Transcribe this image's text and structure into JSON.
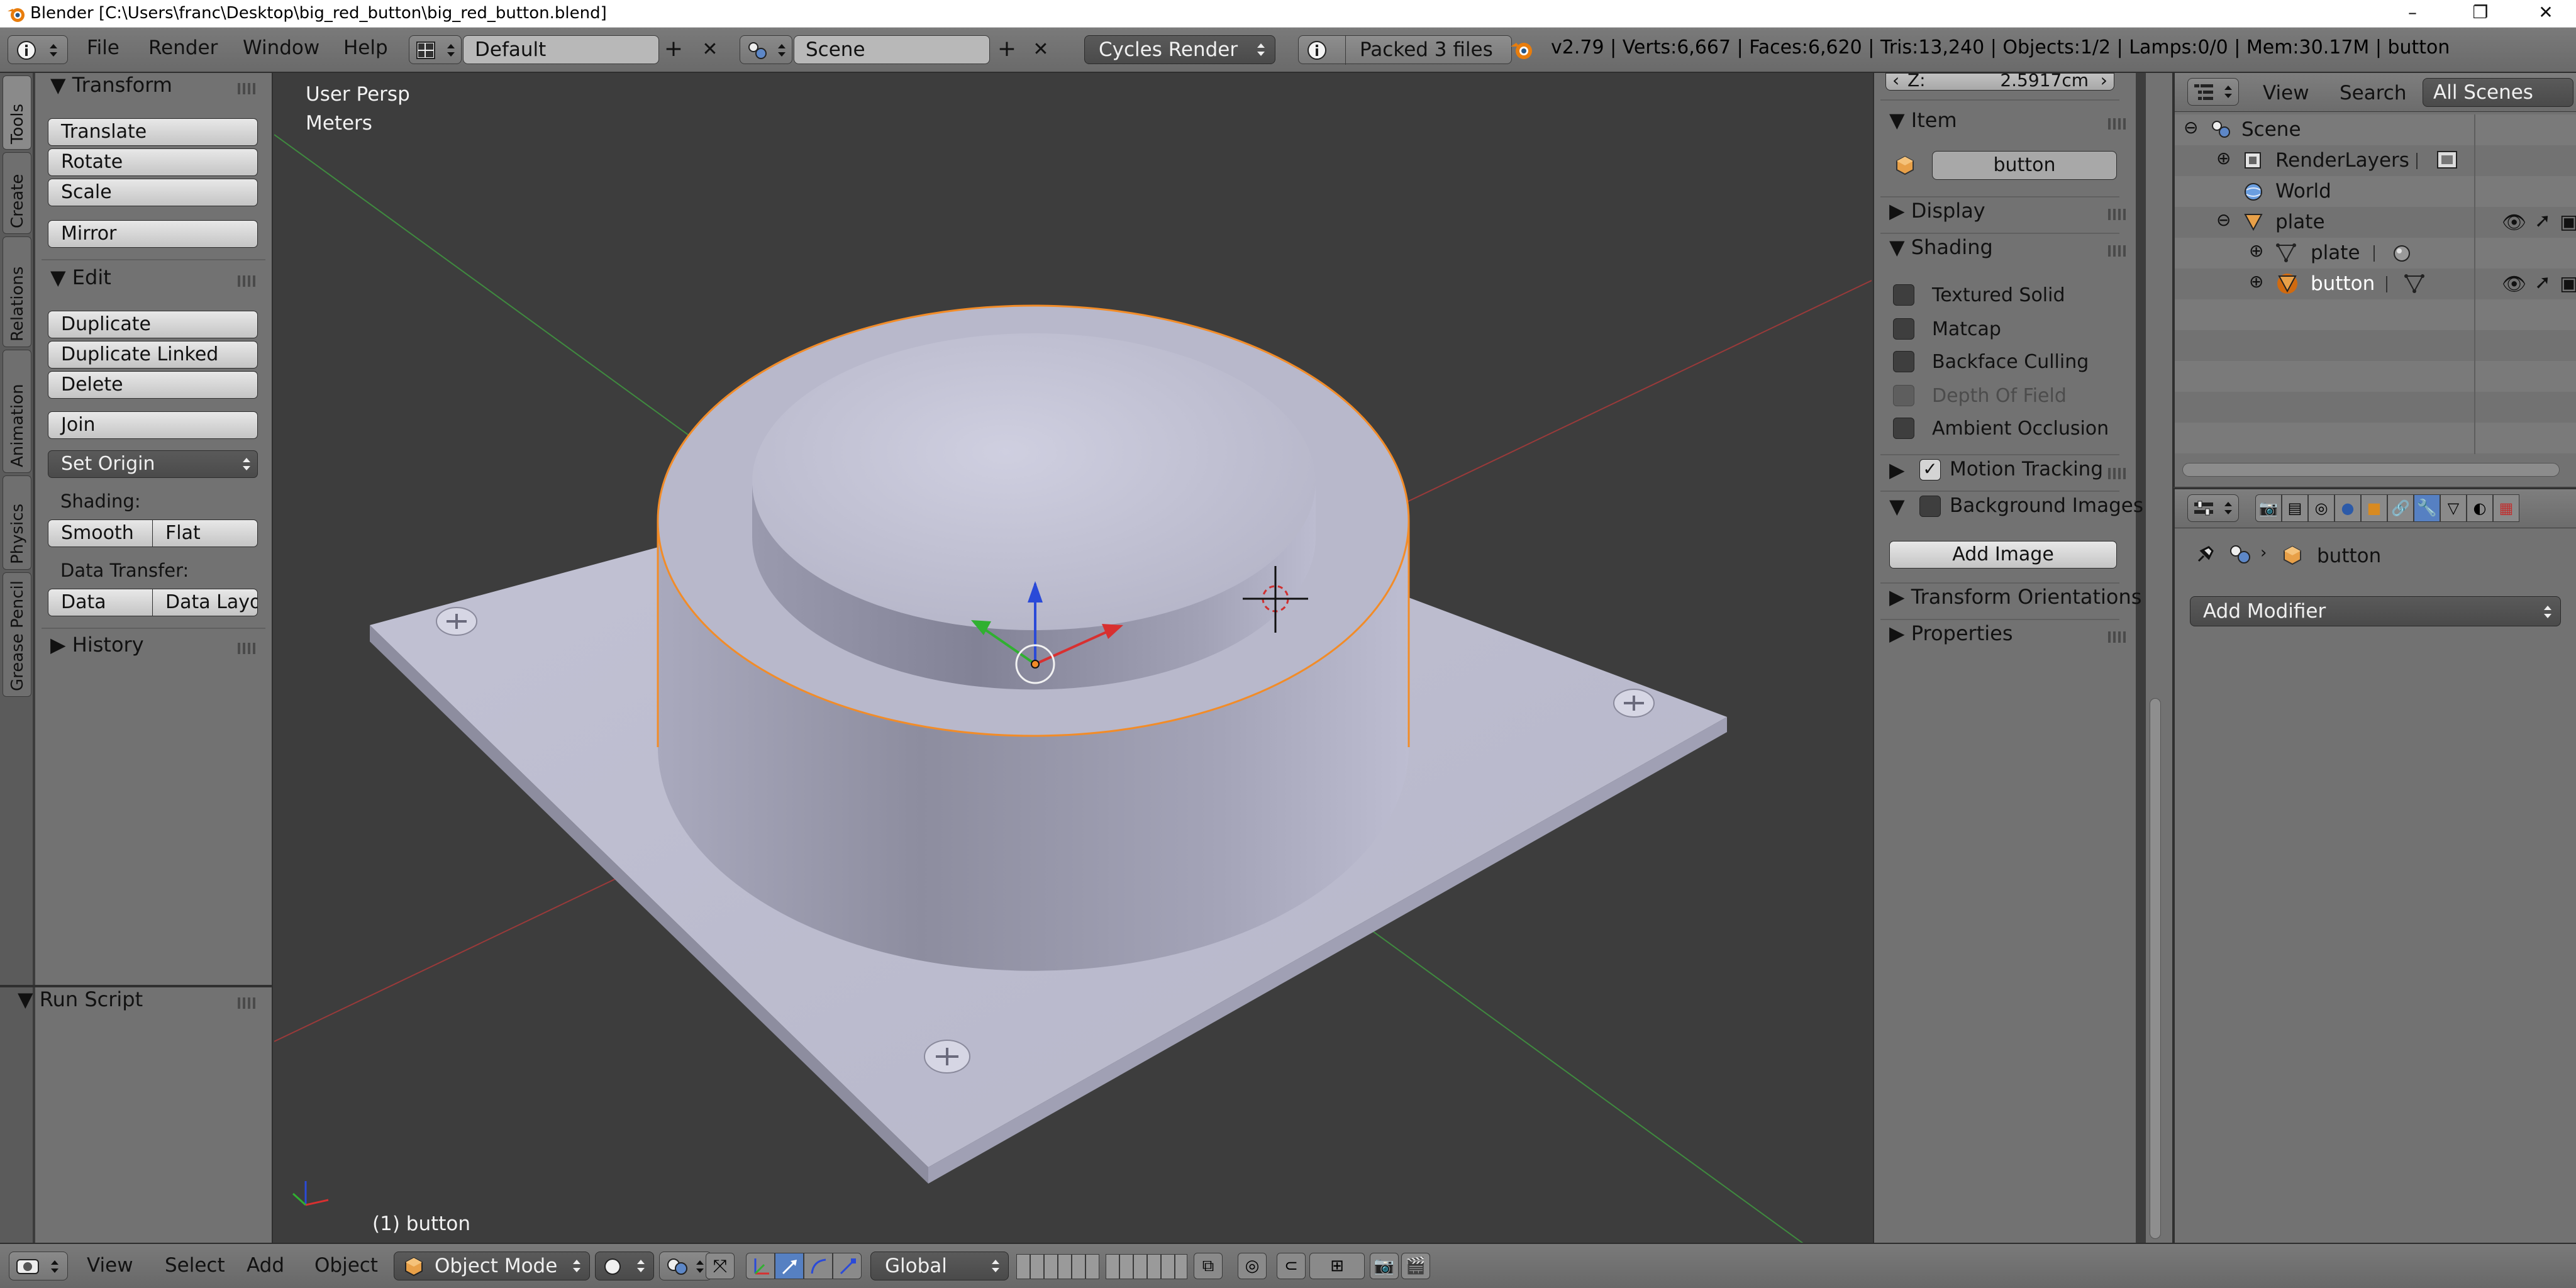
{
  "titlebar": {
    "title": "Blender [C:\\Users\\franc\\Desktop\\big_red_button\\big_red_button.blend]",
    "minimize": "–",
    "restore": "❐",
    "close": "✕"
  },
  "info_header": {
    "menus": [
      "File",
      "Render",
      "Window",
      "Help"
    ],
    "screen_layout": "Default",
    "scene": "Scene",
    "render_engine": "Cycles Render",
    "packed": "Packed 3 files",
    "stats": "v2.79 | Verts:6,667 | Faces:6,620 | Tris:13,240 | Objects:1/2 | Lamps:0/0 | Mem:30.17M | button"
  },
  "tool_tabs": [
    "Tools",
    "Create",
    "Relations",
    "Animation",
    "Physics",
    "Grease Pencil"
  ],
  "toolshelf": {
    "transform_header": "Transform",
    "translate": "Translate",
    "rotate": "Rotate",
    "scale": "Scale",
    "mirror": "Mirror",
    "edit_header": "Edit",
    "duplicate": "Duplicate",
    "duplicate_linked": "Duplicate Linked",
    "delete": "Delete",
    "join": "Join",
    "set_origin": "Set Origin",
    "shading_label": "Shading:",
    "smooth": "Smooth",
    "flat": "Flat",
    "data_transfer_label": "Data Transfer:",
    "data": "Data",
    "data_layout": "Data Layo",
    "history_header": "History",
    "run_script_header": "Run Script"
  },
  "viewport": {
    "view_name": "User Persp",
    "units": "Meters",
    "object_label": "(1) button"
  },
  "npanel": {
    "z_label": "Z:",
    "z_value": "2.5917cm",
    "item_header": "Item",
    "object_name": "button",
    "display_header": "Display",
    "shading_header": "Shading",
    "textured_solid": "Textured Solid",
    "matcap": "Matcap",
    "backface_culling": "Backface Culling",
    "depth_of_field": "Depth Of Field",
    "ambient_occlusion": "Ambient Occlusion",
    "motion_tracking": "Motion Tracking",
    "background_images": "Background Images",
    "add_image": "Add Image",
    "transform_orientations": "Transform Orientations",
    "properties_header": "Properties"
  },
  "outliner": {
    "view": "View",
    "search": "Search",
    "scope": "All Scenes",
    "items": {
      "scene": "Scene",
      "renderlayers": "RenderLayers",
      "world": "World",
      "plate": "plate",
      "plate_mesh": "plate",
      "button": "button"
    }
  },
  "properties_editor": {
    "breadcrumb_object": "button",
    "add_modifier": "Add Modifier"
  },
  "bottom_header": {
    "view": "View",
    "select": "Select",
    "add": "Add",
    "object": "Object",
    "mode": "Object Mode",
    "orientation": "Global"
  },
  "colors": {
    "selection_outline": "#f28c28",
    "active_tab": "#5680c2",
    "viewport_bg": "#3d3d3d",
    "object_gray": "#b3b3c5"
  }
}
